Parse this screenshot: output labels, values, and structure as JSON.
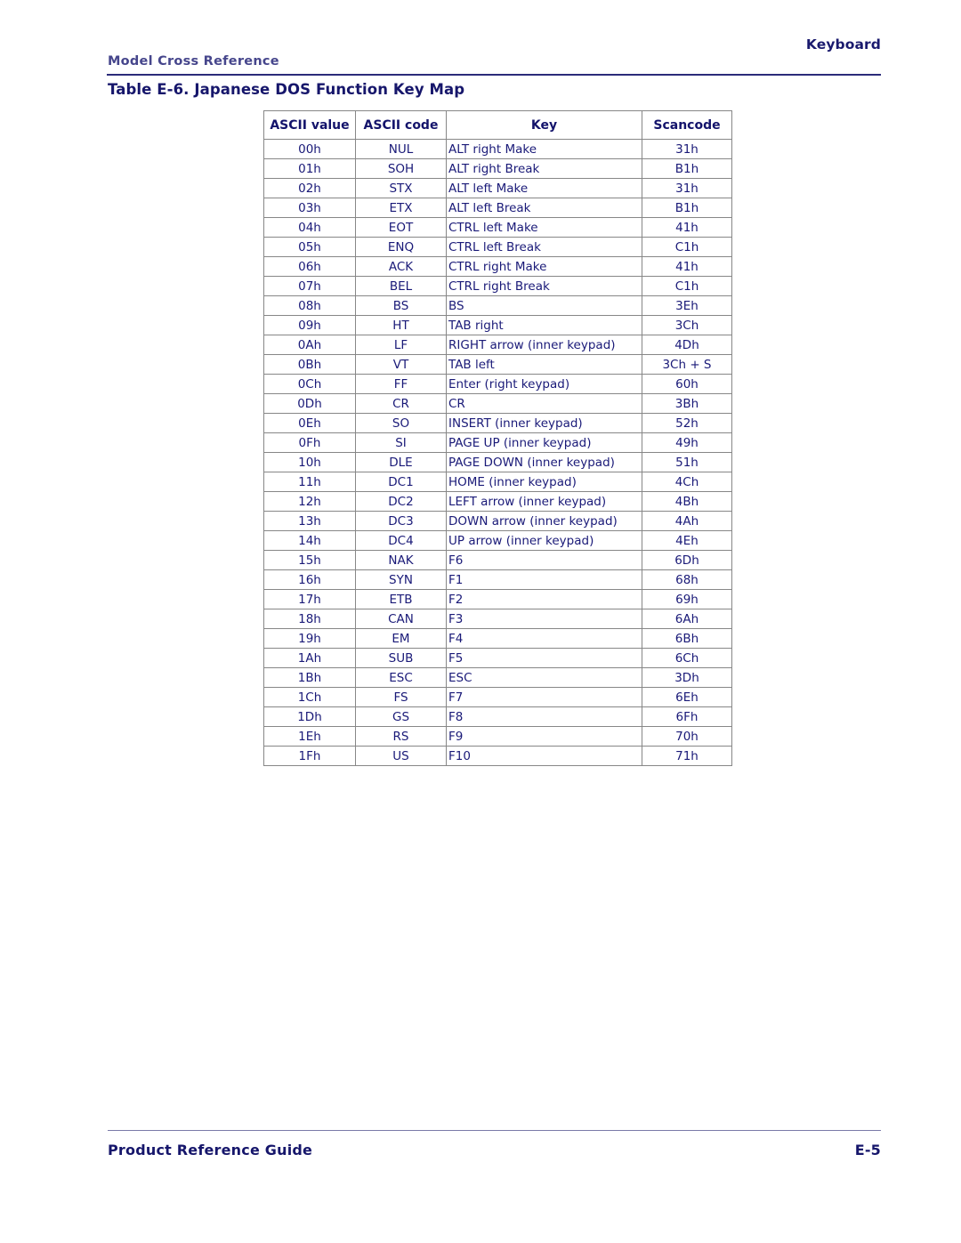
{
  "page": {
    "running_head_right": "Keyboard",
    "running_head_left": "Model Cross Reference",
    "caption": "Table E-6. Japanese DOS Function Key Map",
    "footer_left": "Product Reference Guide",
    "footer_right": "E-5"
  },
  "colors": {
    "text_blue": "#1a1a78",
    "heading_navy": "#16166b",
    "running_head_left": "#46468c",
    "rule_navy": "#2b2b7a",
    "rule_footer": "#7a7aa8",
    "table_border": "#878787",
    "page_background": "#ffffff"
  },
  "table": {
    "columns": [
      "ASCII value",
      "ASCII code",
      "Key",
      "Scancode"
    ],
    "rows": [
      [
        "00h",
        "NUL",
        "ALT right Make",
        "31h"
      ],
      [
        "01h",
        "SOH",
        "ALT right Break",
        "B1h"
      ],
      [
        "02h",
        "STX",
        "ALT left Make",
        "31h"
      ],
      [
        "03h",
        "ETX",
        "ALT left Break",
        "B1h"
      ],
      [
        "04h",
        "EOT",
        "CTRL left Make",
        "41h"
      ],
      [
        "05h",
        "ENQ",
        "CTRL left Break",
        "C1h"
      ],
      [
        "06h",
        "ACK",
        "CTRL right Make",
        "41h"
      ],
      [
        "07h",
        "BEL",
        "CTRL right Break",
        "C1h"
      ],
      [
        "08h",
        "BS",
        "BS",
        "3Eh"
      ],
      [
        "09h",
        "HT",
        "TAB right",
        "3Ch"
      ],
      [
        "0Ah",
        "LF",
        "RIGHT arrow (inner keypad)",
        "4Dh"
      ],
      [
        "0Bh",
        "VT",
        "TAB left",
        "3Ch + S"
      ],
      [
        "0Ch",
        "FF",
        "Enter (right keypad)",
        "60h"
      ],
      [
        "0Dh",
        "CR",
        "CR",
        "3Bh"
      ],
      [
        "0Eh",
        "SO",
        "INSERT (inner keypad)",
        "52h"
      ],
      [
        "0Fh",
        "SI",
        "PAGE UP (inner keypad)",
        "49h"
      ],
      [
        "10h",
        "DLE",
        "PAGE DOWN (inner keypad)",
        "51h"
      ],
      [
        "11h",
        "DC1",
        "HOME (inner keypad)",
        "4Ch"
      ],
      [
        "12h",
        "DC2",
        "LEFT arrow (inner keypad)",
        "4Bh"
      ],
      [
        "13h",
        "DC3",
        "DOWN arrow (inner keypad)",
        "4Ah"
      ],
      [
        "14h",
        "DC4",
        "UP arrow (inner keypad)",
        "4Eh"
      ],
      [
        "15h",
        "NAK",
        "F6",
        "6Dh"
      ],
      [
        "16h",
        "SYN",
        "F1",
        "68h"
      ],
      [
        "17h",
        "ETB",
        "F2",
        "69h"
      ],
      [
        "18h",
        "CAN",
        "F3",
        "6Ah"
      ],
      [
        "19h",
        "EM",
        "F4",
        "6Bh"
      ],
      [
        "1Ah",
        "SUB",
        "F5",
        "6Ch"
      ],
      [
        "1Bh",
        "ESC",
        "ESC",
        "3Dh"
      ],
      [
        "1Ch",
        "FS",
        "F7",
        "6Eh"
      ],
      [
        "1Dh",
        "GS",
        "F8",
        "6Fh"
      ],
      [
        "1Eh",
        "RS",
        "F9",
        "70h"
      ],
      [
        "1Fh",
        "US",
        "F10",
        "71h"
      ]
    ]
  }
}
